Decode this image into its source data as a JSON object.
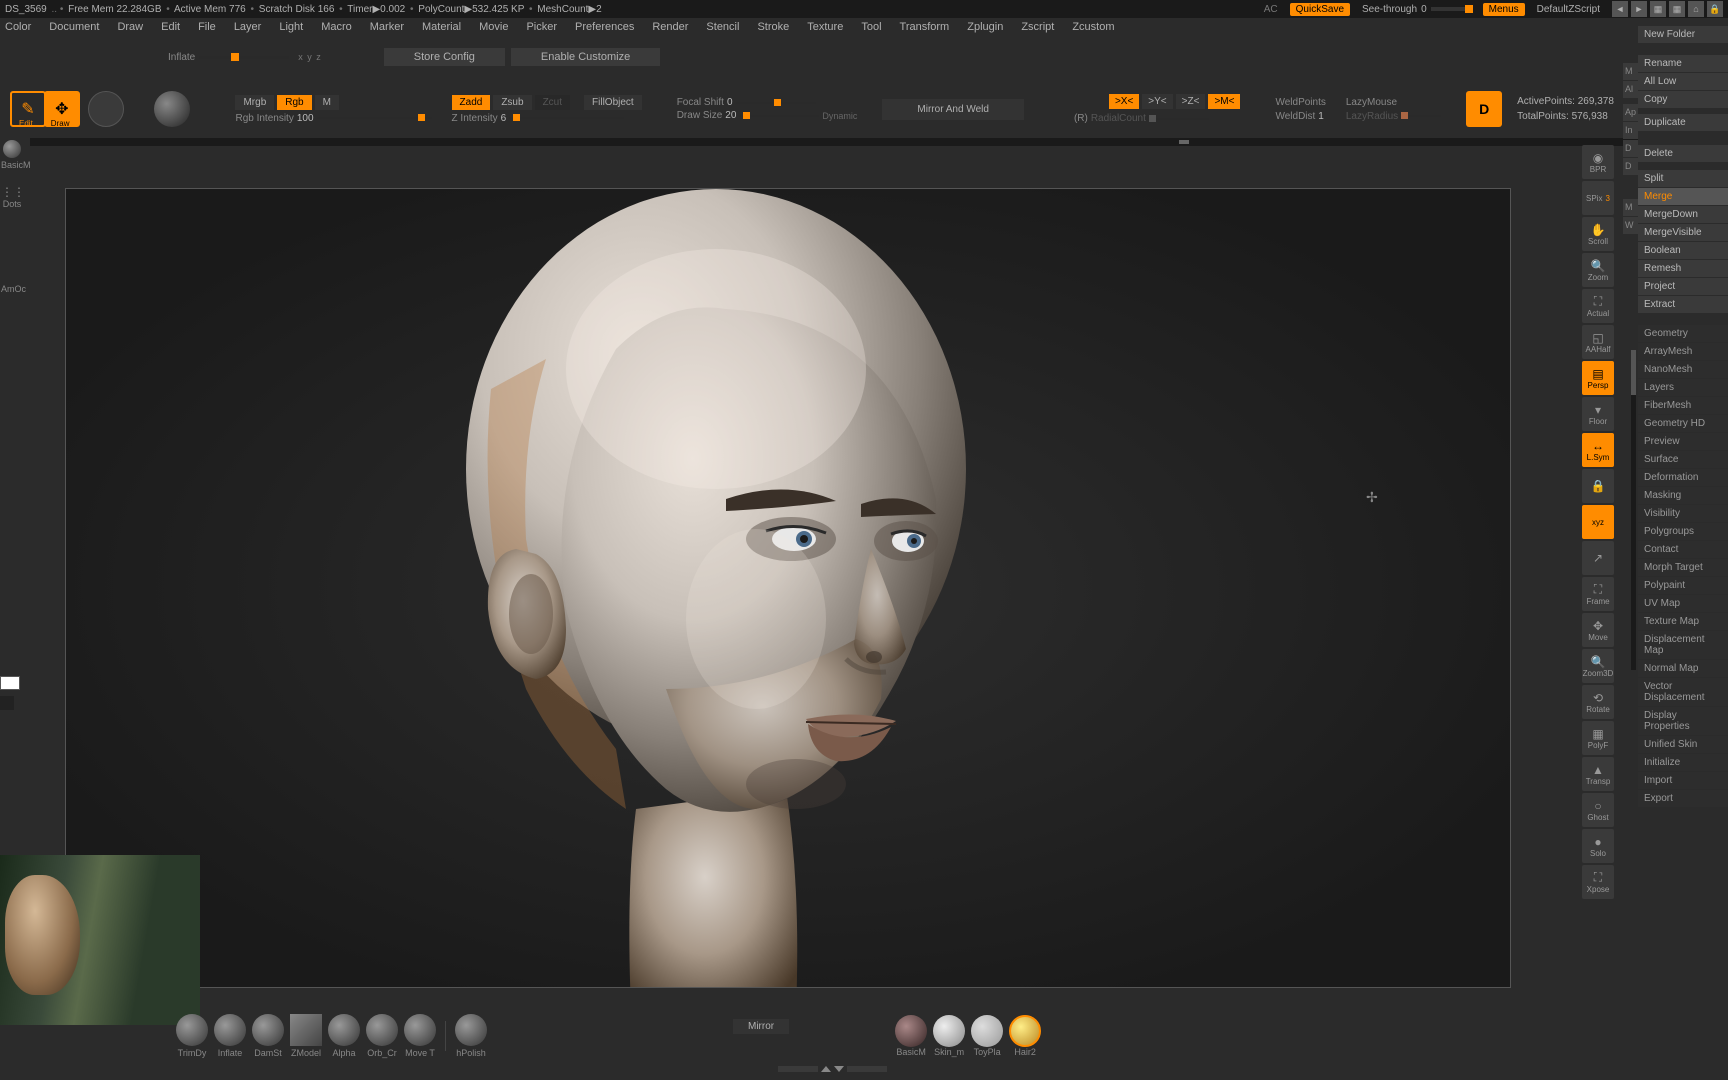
{
  "status": {
    "ds": "DS_3569",
    "freemem": "Free Mem 22.284GB",
    "activemem": "Active Mem 776",
    "scratch": "Scratch Disk 166",
    "timer": "Timer▶0.002",
    "polycount": "PolyCount▶532.425 KP",
    "meshcount": "MeshCount▶2",
    "ac": "AC",
    "quicksave": "QuickSave",
    "seethrough": "See-through",
    "seethrough_val": "0",
    "menus": "Menus",
    "script": "DefaultZScript"
  },
  "menu": [
    "Color",
    "Document",
    "Draw",
    "Edit",
    "File",
    "Layer",
    "Light",
    "Macro",
    "Marker",
    "Material",
    "Movie",
    "Picker",
    "Preferences",
    "Render",
    "Stencil",
    "Stroke",
    "Texture",
    "Tool",
    "Transform",
    "Zplugin",
    "Zscript",
    "Zcustom"
  ],
  "config": {
    "inflate": "Inflate",
    "xyz": "x y z",
    "store": "Store Config",
    "enable": "Enable Customize"
  },
  "tool": {
    "edit": "Edit",
    "draw": "Draw",
    "mrgb": "Mrgb",
    "rgb": "Rgb",
    "m": "M",
    "zadd": "Zadd",
    "zsub": "Zsub",
    "zcut": "Zcut",
    "fillobj": "FillObject",
    "rgbint": "Rgb Intensity",
    "rgbint_v": "100",
    "zint": "Z Intensity",
    "zint_v": "6",
    "focal": "Focal Shift",
    "focal_v": "0",
    "drawsize": "Draw Size",
    "drawsize_v": "20",
    "dynamic": "Dynamic",
    "mirror": "Mirror And Weld",
    "sx": ">X<",
    "sy": ">Y<",
    "sz": ">Z<",
    "sm": ">M<",
    "r": "(R)",
    "radial": "RadialCount",
    "weldpts": "WeldPoints",
    "welddist": "WeldDist",
    "welddist_v": "1",
    "lazy": "LazyMouse",
    "lazyrad": "LazyRadius",
    "activepts": "ActivePoints:",
    "activepts_v": "269,378",
    "totalpts": "TotalPoints:",
    "totalpts_v": "576,938"
  },
  "left": {
    "basicm": "BasicM",
    "dots": "Dots",
    "amoc": "AmOc"
  },
  "rv": {
    "bpr": "BPR",
    "spix": "SPix",
    "spix_v": "3",
    "scroll": "Scroll",
    "zoom": "Zoom",
    "actual": "Actual",
    "aahalf": "AAHalf",
    "persp": "Persp",
    "floor": "Floor",
    "lsym": "L.Sym",
    "lock": "",
    "xyz": "xyz",
    "frame": "Frame",
    "move": "Move",
    "zoom3d": "Zoom3D",
    "rotate": "Rotate",
    "polyf": "PolyF",
    "transp": "Transp",
    "ghost": "Ghost",
    "solo": "Solo",
    "xpose": "Xpose"
  },
  "rp": {
    "newfolder": "New Folder",
    "rename": "Rename",
    "alllow": "All Low",
    "copy": "Copy",
    "duplicate": "Duplicate",
    "delete": "Delete",
    "split": "Split",
    "merge": "Merge",
    "mergedown": "MergeDown",
    "mergevis": "MergeVisible",
    "boolean": "Boolean",
    "remesh": "Remesh",
    "project": "Project",
    "extract": "Extract",
    "geometry": "Geometry",
    "arraymesh": "ArrayMesh",
    "nanomesh": "NanoMesh",
    "layers": "Layers",
    "fibermesh": "FiberMesh",
    "geomhd": "Geometry HD",
    "preview": "Preview",
    "surface": "Surface",
    "deform": "Deformation",
    "masking": "Masking",
    "visibility": "Visibility",
    "polygroups": "Polygroups",
    "contact": "Contact",
    "morph": "Morph Target",
    "polypaint": "Polypaint",
    "uvmap": "UV Map",
    "texmap": "Texture Map",
    "dispmap": "Displacement Map",
    "normmap": "Normal Map",
    "vecdisp": "Vector Displacement",
    "dispprop": "Display Properties",
    "unified": "Unified Skin",
    "init": "Initialize",
    "import": "Import",
    "export": "Export"
  },
  "rp2": {
    "m": "M",
    "a1": "Al",
    "a2": "Ap",
    "i1": "In",
    "d1": "D",
    "d2": "D",
    "m2": "M",
    "w": "W"
  },
  "shelf": {
    "clay": "TrimDy",
    "inflate": "Inflate",
    "damst": "DamSt",
    "zmodel": "ZModel",
    "alpha": "Alpha",
    "orbcr": "Orb_Cr",
    "movet": "Move T",
    "hpolish": "hPolish",
    "mirror": "Mirror",
    "basicm": "BasicM",
    "skinm": "Skin_m",
    "toypla": "ToyPla",
    "hair2": "Hair2"
  }
}
